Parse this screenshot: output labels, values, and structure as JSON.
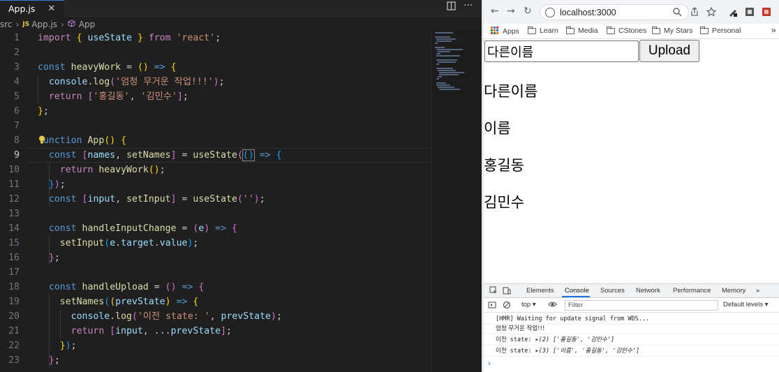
{
  "editor": {
    "tab_label": "App.js",
    "tab_close": "✕",
    "breadcrumb": {
      "folder": "src",
      "sep1": "›",
      "js_badge": "JS",
      "file": "App.js",
      "sep2": "›",
      "symbol": "App"
    },
    "line_numbers": [
      "1",
      "2",
      "3",
      "4",
      "5",
      "6",
      "7",
      "8",
      "9",
      "10",
      "11",
      "12",
      "13",
      "14",
      "15",
      "16",
      "17",
      "18",
      "19",
      "20",
      "21",
      "22",
      "23"
    ],
    "active_line": "9"
  },
  "browser": {
    "url": "localhost:3000",
    "bookmarks": [
      "Apps",
      "Learn",
      "Media",
      "CStones",
      "My Stars",
      "Personal"
    ],
    "bookmarks_more": "»",
    "input_value": "다른이름",
    "upload_label": "Upload",
    "names": [
      "다른이름",
      "이름",
      "홍길동",
      "김민수"
    ]
  },
  "devtools": {
    "tabs": [
      "Elements",
      "Console",
      "Sources",
      "Network",
      "Performance",
      "Memory",
      "»"
    ],
    "selected_tab": "Console",
    "context": "top ▾",
    "filter_placeholder": "Filter",
    "levels": "Default levels ▾",
    "logs": {
      "hmr": "[HMR] Waiting for update signal from WDS...",
      "heavy": "엄청 무거운 작업!!!",
      "prev1_label": "이전 state:",
      "prev1_value": "▸(2) ['홍길동', '김민수']",
      "prev2_label": "이전 state:",
      "prev2_value": "▸(3) ['이름', '홍길동', '김민수']"
    },
    "prompt": "›"
  },
  "colors": {
    "keyword": "#569cd6",
    "control": "#c586c0",
    "function": "#dcdcaa",
    "variable": "#9cdcfe",
    "string": "#ce9178",
    "accent": "#1a73e8"
  }
}
